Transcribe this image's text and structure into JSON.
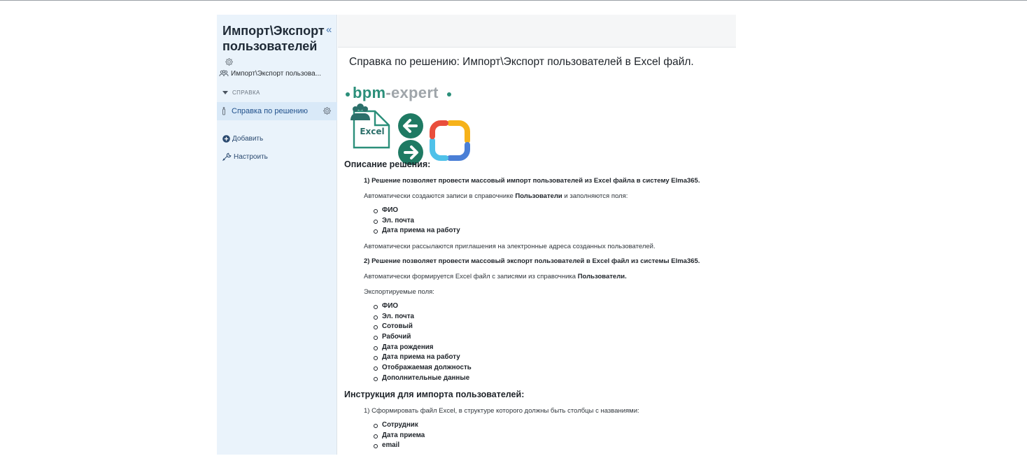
{
  "sidebar": {
    "app_title_line1": "Импорт\\Экспорт",
    "app_title_line2": "пользователей",
    "collapse_icon": "«",
    "nav_item": "Импорт\\Экспорт пользова...",
    "section_label": "СПРАВКА",
    "active_item": "Справка по решению",
    "add_label": "Добавить",
    "config_label": "Настроить"
  },
  "main": {
    "title": "Справка по решению: Импорт\\Экспорт пользователей в Excel файл.",
    "logo": {
      "brand_part1": "bpm",
      "brand_part2": "-expert",
      "excel_label": "Excel"
    },
    "section1_heading": "Описание решения:",
    "p1": "1) Решение позволяет провести массовый импорт пользователей из Excel файла в систему Elma365.",
    "p2_before": "Автоматически создаются записи в справочнике ",
    "p2_bold": "Пользователи",
    "p2_after": " и заполняются поля:",
    "list1": [
      "ФИО",
      "Эл. почта",
      "Дата приема на работу"
    ],
    "p3": "Автоматически рассылаются приглашения на электронные адреса созданных пользователей.",
    "p4": "2) Решение позволяет провести массовый экспорт пользователей в Excel файл из системы Elma365.",
    "p5_before": "Автоматически формируется Excel файл с записями из справочника ",
    "p5_bold": "Пользователи.",
    "p6": "Экспортируемые поля:",
    "list2": [
      "ФИО",
      "Эл. почта",
      "Сотовый",
      "Рабочий",
      "Дата рождения",
      "Дата приема на работу",
      "Отображаемая должность",
      "Дополнительные данные"
    ],
    "section2_heading": "Инструкция для импорта пользователей:",
    "p7": "1) Сформировать файл Excel, в структуре которого должны быть столбцы с названиями:",
    "list3": [
      "Сотрудник",
      "Дата приема",
      "email"
    ]
  },
  "colors": {
    "sidebar_bg": "#eaf3fb",
    "active_bg": "#d9e9f8",
    "brand_green": "#2b8f7a",
    "arrow_green": "#1f7a63",
    "accent_blue": "#4a7bb5"
  }
}
